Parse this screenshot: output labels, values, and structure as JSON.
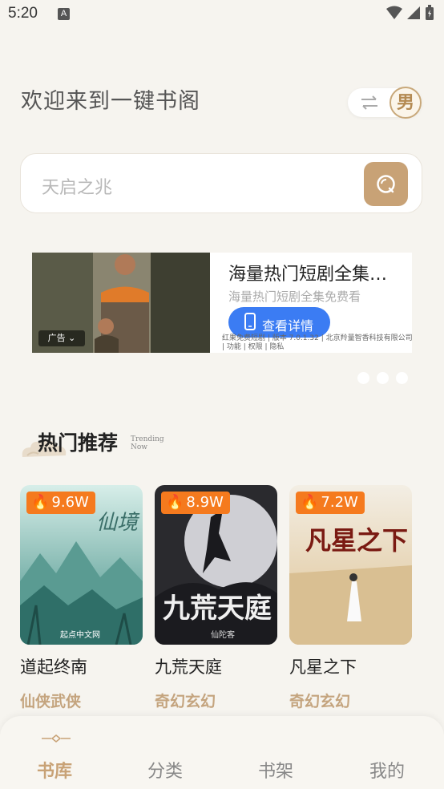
{
  "status_bar": {
    "time": "5:20",
    "notif_letter": "A"
  },
  "header": {
    "welcome": "欢迎来到一键书阁",
    "gender": "男"
  },
  "search": {
    "placeholder": "天启之兆"
  },
  "ad": {
    "title": "海量热门短剧全集…",
    "subtitle": "海量热门短剧全集免费看",
    "button": "查看详情",
    "fine_print": "红果免费短剧 | 版本 7.0.1.32 | 北京羚量智香科技有限公司 | 功能 | 权限 | 隐私",
    "tag": "广告",
    "carousel_pages": 3
  },
  "section": {
    "title": "热门推荐",
    "sub_line1": "Trending",
    "sub_line2": "Now"
  },
  "books": [
    {
      "title": "道起终南",
      "category": "仙侠武侠",
      "heat": "9.6W"
    },
    {
      "title": "九荒天庭",
      "category": "奇幻玄幻",
      "heat": "8.9W"
    },
    {
      "title": "凡星之下",
      "category": "奇幻玄幻",
      "heat": "7.2W"
    }
  ],
  "nav": {
    "items": [
      "书库",
      "分类",
      "书架",
      "我的"
    ],
    "active": 0
  },
  "colors": {
    "accent": "#c8a276",
    "heat": "#f57a1e",
    "ad_button": "#3b7cf3"
  }
}
